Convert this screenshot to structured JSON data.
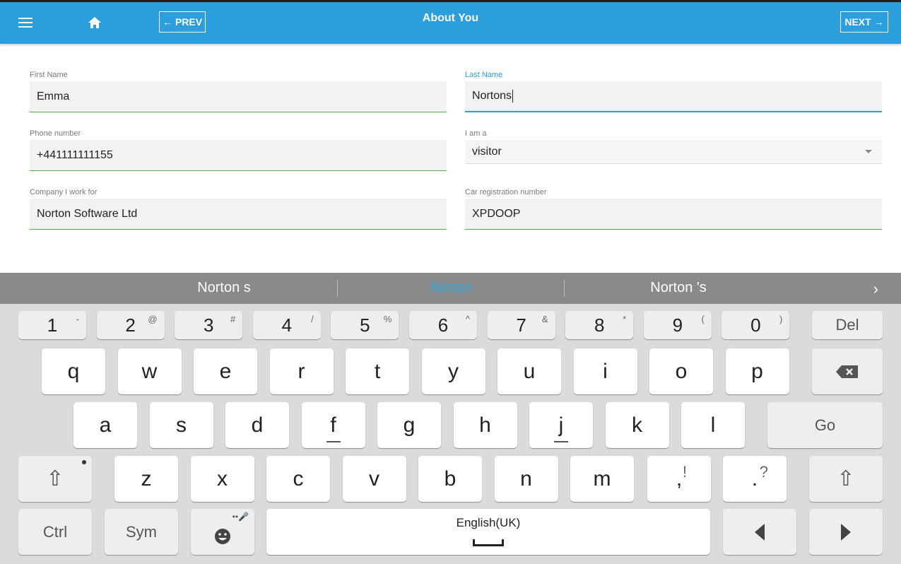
{
  "header": {
    "title": "About You",
    "prev_label": "PREV",
    "next_label": "NEXT",
    "color": "#2a9fdb"
  },
  "form": {
    "first_name": {
      "label": "First Name",
      "value": "Emma"
    },
    "last_name": {
      "label": "Last Name",
      "value": "Nortons"
    },
    "phone": {
      "label": "Phone number",
      "value": "+441111111155"
    },
    "role": {
      "label": "I am a",
      "value": "visitor"
    },
    "company": {
      "label": "Company I work for",
      "value": "Norton Software Ltd"
    },
    "car_reg": {
      "label": "Car registration number",
      "value": "XPDOOP"
    }
  },
  "keyboard": {
    "suggestions": [
      "Norton s",
      "Norton",
      "Norton 's"
    ],
    "row_numbers": [
      {
        "main": "1",
        "sup": "-"
      },
      {
        "main": "2",
        "sup": "@"
      },
      {
        "main": "3",
        "sup": "#"
      },
      {
        "main": "4",
        "sup": "/"
      },
      {
        "main": "5",
        "sup": "%"
      },
      {
        "main": "6",
        "sup": "^"
      },
      {
        "main": "7",
        "sup": "&"
      },
      {
        "main": "8",
        "sup": "*"
      },
      {
        "main": "9",
        "sup": "("
      },
      {
        "main": "0",
        "sup": ")"
      }
    ],
    "del": "Del",
    "row_q": [
      "q",
      "w",
      "e",
      "r",
      "t",
      "y",
      "u",
      "i",
      "o",
      "p"
    ],
    "row_a": [
      "a",
      "s",
      "d",
      "f",
      "g",
      "h",
      "j",
      "k",
      "l"
    ],
    "go": "Go",
    "row_z": [
      "z",
      "x",
      "c",
      "v",
      "b",
      "n",
      "m"
    ],
    "comma": {
      "main": ",",
      "sup": "!"
    },
    "period": {
      "main": ".",
      "sup": "?"
    },
    "ctrl": "Ctrl",
    "sym": "Sym",
    "space_label": "English(UK)"
  }
}
